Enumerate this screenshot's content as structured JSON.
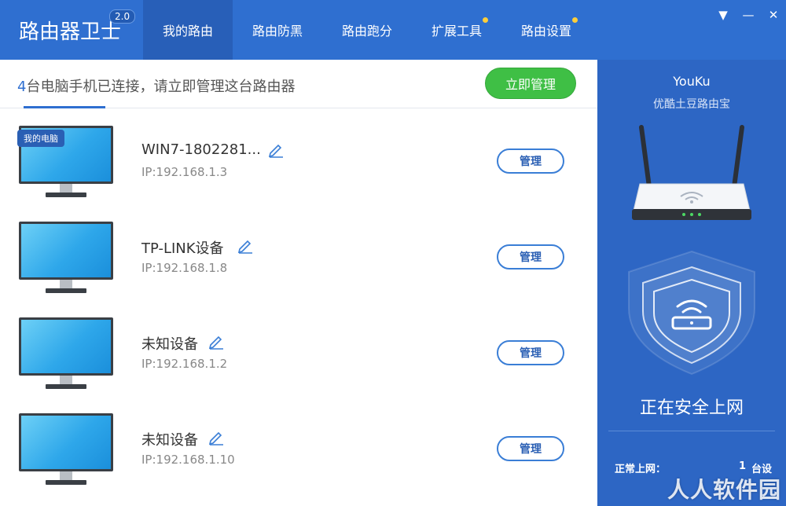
{
  "app": {
    "title": "路由器卫士",
    "version": "2.0"
  },
  "nav": {
    "tabs": [
      {
        "label": "我的路由",
        "active": true,
        "dot": false
      },
      {
        "label": "路由防黑",
        "active": false,
        "dot": false
      },
      {
        "label": "路由跑分",
        "active": false,
        "dot": false
      },
      {
        "label": "扩展工具",
        "active": false,
        "dot": true
      },
      {
        "label": "路由设置",
        "active": false,
        "dot": true
      }
    ]
  },
  "window_controls": {
    "menu": "▼",
    "minimize": "—",
    "close": "✕"
  },
  "status": {
    "count": "4",
    "text": "台电脑手机已连接，请立即管理这台路由器",
    "manage_now_label": "立即管理"
  },
  "devices": [
    {
      "badge": "我的电脑",
      "name": "WIN7-1802281...",
      "ip": "IP:192.168.1.3",
      "button": "管理"
    },
    {
      "badge": "",
      "name": "TP-LINK设备",
      "ip": "IP:192.168.1.8",
      "button": "管理"
    },
    {
      "badge": "",
      "name": "未知设备",
      "ip": "IP:192.168.1.2",
      "button": "管理"
    },
    {
      "badge": "",
      "name": "未知设备",
      "ip": "IP:192.168.1.10",
      "button": "管理"
    }
  ],
  "side": {
    "router_name": "YouKu",
    "router_model": "优酷土豆路由宝",
    "status": "正在安全上网",
    "online_label": "正常上网：",
    "online_count": "1",
    "online_unit": "台设",
    "watermark": "人人软件园"
  },
  "colors": {
    "header": "#2f6fd0",
    "accent_green": "#3fbf45",
    "side_panel": "#2d66c4",
    "nav_dot": "#ffcf3a"
  },
  "icons": {
    "edit": "pencil-icon",
    "router": "router-icon",
    "shield": "shield-wifi-icon",
    "monitor": "monitor-icon"
  }
}
